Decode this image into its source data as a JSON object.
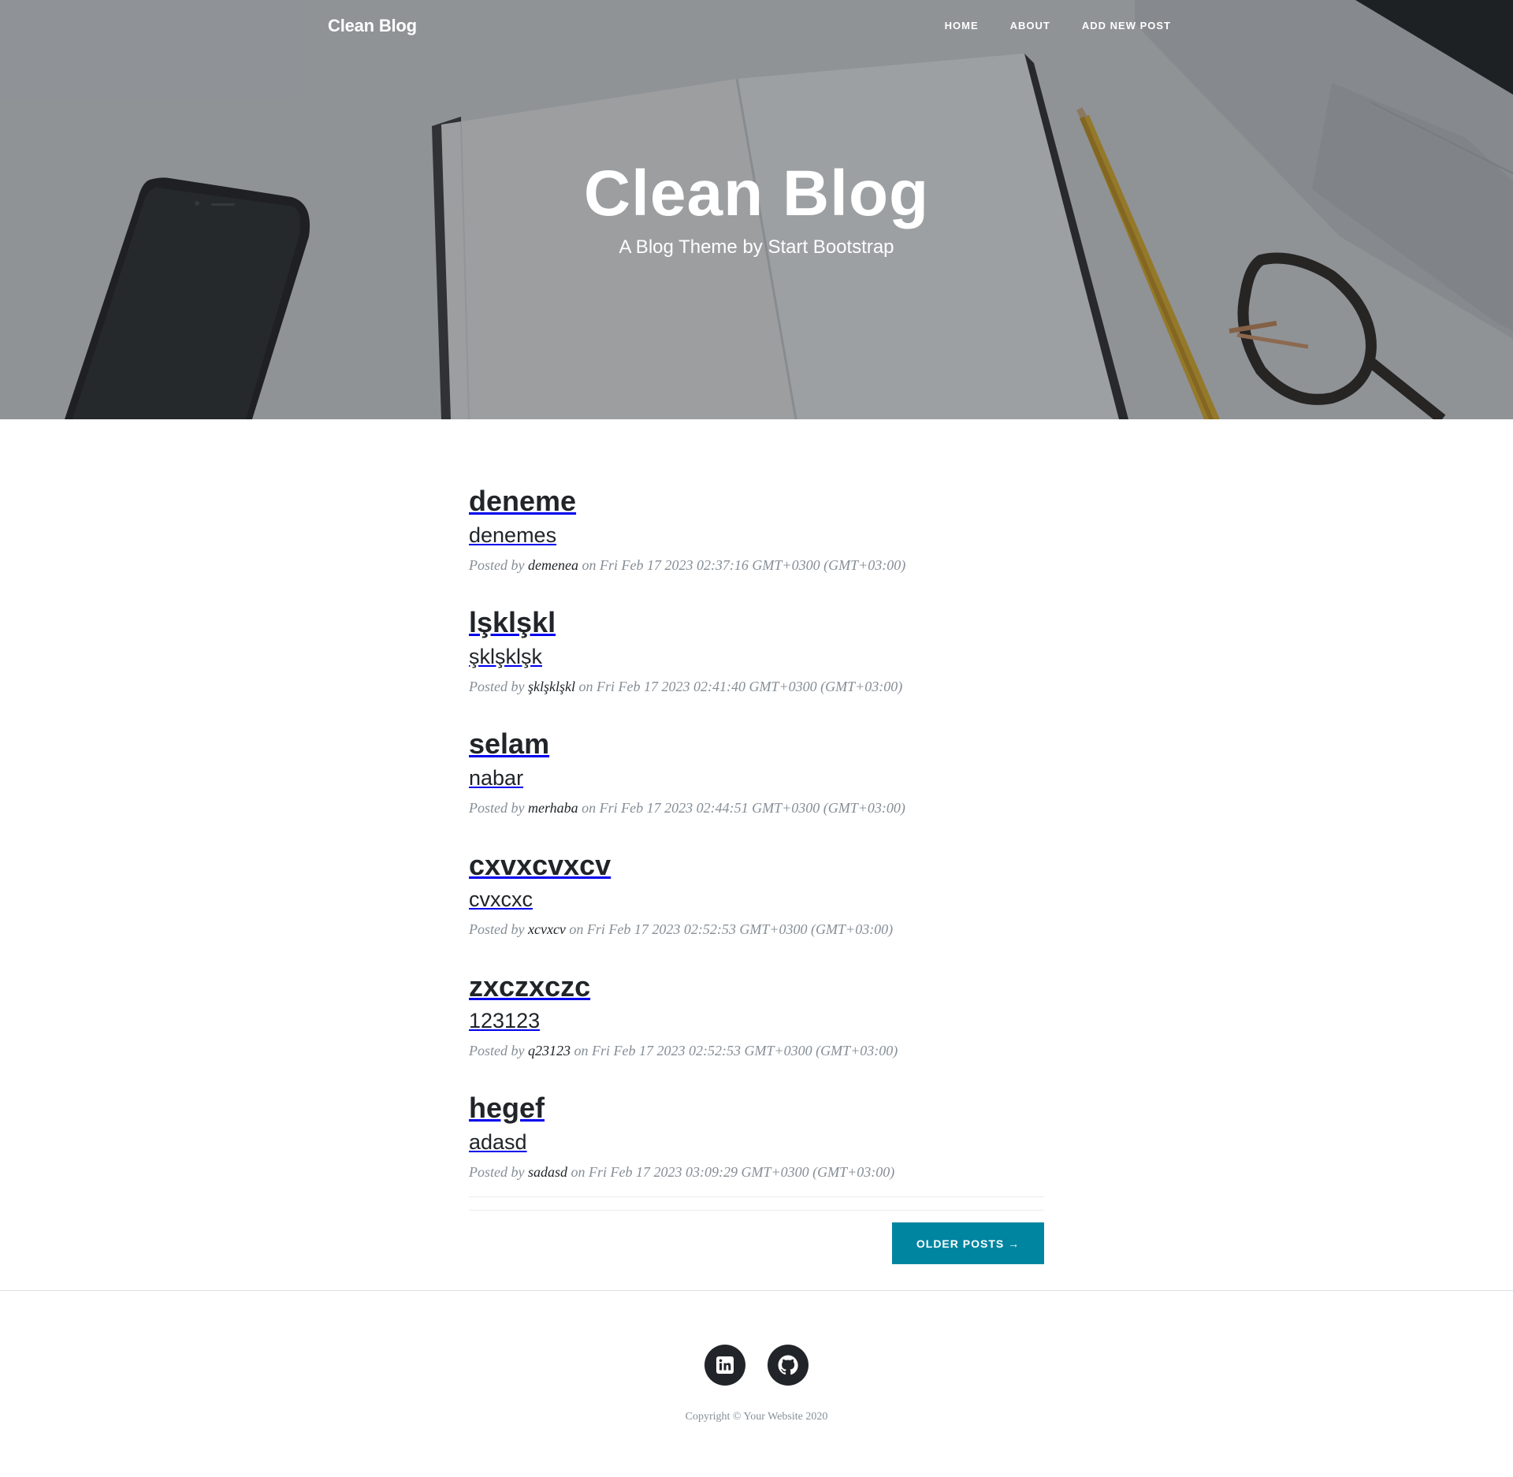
{
  "navbar": {
    "brand": "Clean Blog",
    "links": [
      {
        "label": "Home"
      },
      {
        "label": "About"
      },
      {
        "label": "Add New Post"
      }
    ]
  },
  "hero": {
    "title": "Clean Blog",
    "subtitle": "A Blog Theme by Start Bootstrap"
  },
  "posts": [
    {
      "title": "deneme",
      "subtitle": "denemes",
      "posted_by": "Posted by",
      "author": "demenea",
      "on": "on",
      "date": "Fri Feb 17 2023 02:37:16 GMT+0300 (GMT+03:00)"
    },
    {
      "title": "lşklşkl",
      "subtitle": "şklşklşk",
      "posted_by": "Posted by",
      "author": "şklşklşkl",
      "on": "on",
      "date": "Fri Feb 17 2023 02:41:40 GMT+0300 (GMT+03:00)"
    },
    {
      "title": "selam",
      "subtitle": "nabar",
      "posted_by": "Posted by",
      "author": "merhaba",
      "on": "on",
      "date": "Fri Feb 17 2023 02:44:51 GMT+0300 (GMT+03:00)"
    },
    {
      "title": "cxvxcvxcv",
      "subtitle": "cvxcxc",
      "posted_by": "Posted by",
      "author": "xcvxcv",
      "on": "on",
      "date": "Fri Feb 17 2023 02:52:53 GMT+0300 (GMT+03:00)"
    },
    {
      "title": "zxczxczc",
      "subtitle": "123123",
      "posted_by": "Posted by",
      "author": "q23123",
      "on": "on",
      "date": "Fri Feb 17 2023 02:52:53 GMT+0300 (GMT+03:00)"
    },
    {
      "title": "hegef",
      "subtitle": "adasd",
      "posted_by": "Posted by",
      "author": "sadasd",
      "on": "on",
      "date": "Fri Feb 17 2023 03:09:29 GMT+0300 (GMT+03:00)"
    }
  ],
  "pager": {
    "older_label": "Older Posts →"
  },
  "footer": {
    "social": [
      {
        "icon": "linkedin-icon"
      },
      {
        "icon": "github-icon"
      }
    ],
    "copyright": "Copyright © Your Website 2020"
  },
  "colors": {
    "accent": "#0085a1",
    "text": "#212529",
    "muted": "#868e96"
  }
}
